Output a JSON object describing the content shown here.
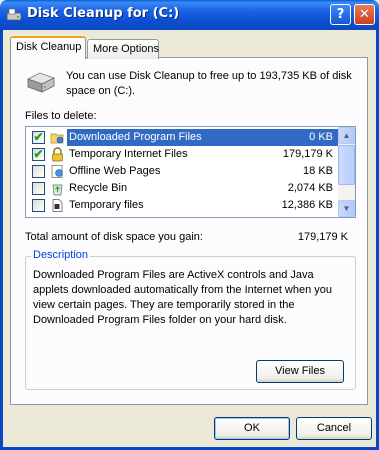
{
  "window": {
    "title": "Disk Cleanup for  (C:)",
    "help_label": "?",
    "close_label": "✕"
  },
  "tabs": [
    {
      "label": "Disk Cleanup",
      "active": true
    },
    {
      "label": "More Options",
      "active": false
    }
  ],
  "intro_text": "You can use Disk Cleanup to free up to 193,735 KB of disk space on  (C:).",
  "files_label": "Files to delete:",
  "files": [
    {
      "name": "Downloaded Program Files",
      "size": "0 KB",
      "checked": true,
      "selected": true,
      "icon": "folder-globe-icon"
    },
    {
      "name": "Temporary Internet Files",
      "size": "179,179 K",
      "checked": true,
      "selected": false,
      "icon": "lock-icon"
    },
    {
      "name": "Offline Web Pages",
      "size": "18 KB",
      "checked": false,
      "selected": false,
      "icon": "web-page-icon"
    },
    {
      "name": "Recycle Bin",
      "size": "2,074 KB",
      "checked": false,
      "selected": false,
      "icon": "recycle-bin-icon"
    },
    {
      "name": "Temporary files",
      "size": "12,386 KB",
      "checked": false,
      "selected": false,
      "icon": "file-icon"
    }
  ],
  "check_mark": "✔",
  "scroll_up": "▲",
  "scroll_down": "▼",
  "total_label": "Total amount of disk space you gain:",
  "total_value": "179,179 K",
  "description": {
    "title": "Description",
    "text": "Downloaded Program Files are ActiveX controls and Java applets downloaded automatically from the Internet when you view certain pages. They are temporarily stored in the Downloaded Program Files folder on your hard disk."
  },
  "buttons": {
    "view_files": "View Files",
    "ok": "OK",
    "cancel": "Cancel"
  },
  "colors": {
    "selection": "#316ac5",
    "title_bar": "#0b4fd0",
    "group_title": "#0046d5"
  }
}
